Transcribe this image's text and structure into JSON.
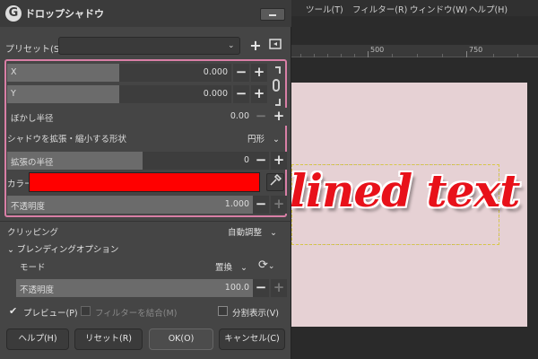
{
  "background_window": {
    "menu": [
      "ツール(T)",
      "フィルター(R)",
      "ウィンドウ(W)",
      "ヘルプ(H)"
    ],
    "ruler_labels": [
      "500",
      "750"
    ],
    "canvas_text": "lined text",
    "canvas_color": "#e6d1d4",
    "text_color": "#e8111a"
  },
  "dialog": {
    "logo": "G",
    "title": "ドロップシャドウ",
    "presets": {
      "label": "プリセット(S):",
      "value": ""
    },
    "sliders": {
      "x": {
        "label": "X",
        "value": "0.000",
        "level": 0.5
      },
      "y": {
        "label": "Y",
        "value": "0.000",
        "level": 0.5
      },
      "blur": {
        "label": "ぼかし半径",
        "value": "0.00",
        "level": 0
      },
      "grow_radius": {
        "label": "拡張の半径",
        "value": "0",
        "level": 0.55
      },
      "opacity": {
        "label": "不透明度",
        "value": "1.000",
        "level": 1.0
      }
    },
    "grow_shape": {
      "label": "シャドウを拡張・縮小する形状",
      "value": "円形"
    },
    "color": {
      "label": "カラー",
      "value": "#ff0000"
    },
    "clipping": {
      "label": "クリッピング",
      "value": "自動調整"
    },
    "blending": {
      "title": "ブレンディングオプション",
      "mode": {
        "label": "モード",
        "value": "置換"
      },
      "opacity": {
        "label": "不透明度",
        "value": "100.0",
        "level": 1.0
      }
    },
    "preview": {
      "label": "プレビュー(P)",
      "checked": true
    },
    "merge_filter": {
      "label": "フィルターを結合(M)",
      "checked": false
    },
    "split_view": {
      "label": "分割表示(V)",
      "checked": false
    },
    "buttons": {
      "help": "ヘルプ(H)",
      "reset": "リセット(R)",
      "ok": "OK(O)",
      "cancel": "キャンセル(C)"
    }
  }
}
